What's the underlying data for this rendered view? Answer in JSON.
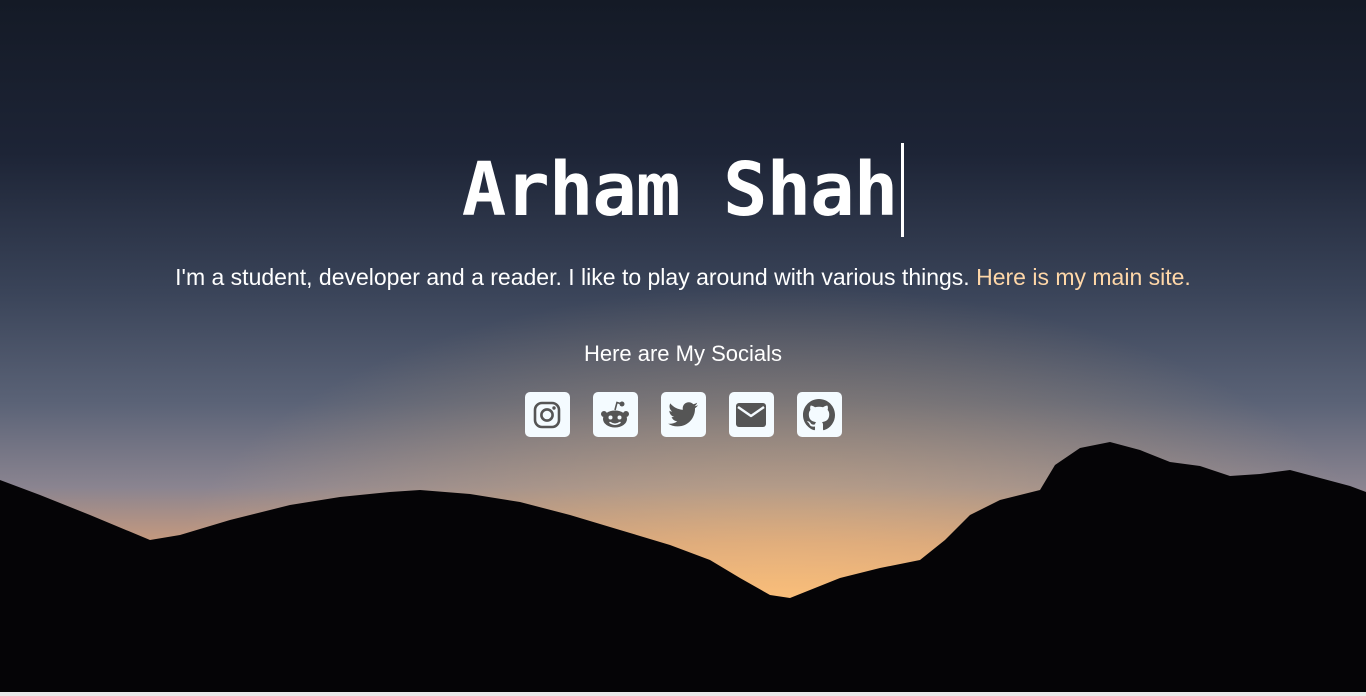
{
  "hero": {
    "name": "Arham Shah",
    "tagline": "I'm a student, developer and a reader. I like to play around with various things.",
    "main_site_link": "Here is my main site.",
    "socials_heading": "Here are My Socials"
  },
  "socials": [
    {
      "name": "Instagram",
      "icon": "instagram-icon"
    },
    {
      "name": "Reddit",
      "icon": "reddit-icon"
    },
    {
      "name": "Twitter",
      "icon": "twitter-icon"
    },
    {
      "name": "Email",
      "icon": "envelope-icon"
    },
    {
      "name": "GitHub",
      "icon": "github-icon"
    }
  ],
  "colors": {
    "link": "#ffd7a8",
    "text": "#ffffff",
    "icon_bg": "#f4fbff",
    "icon_fg": "#555555"
  }
}
